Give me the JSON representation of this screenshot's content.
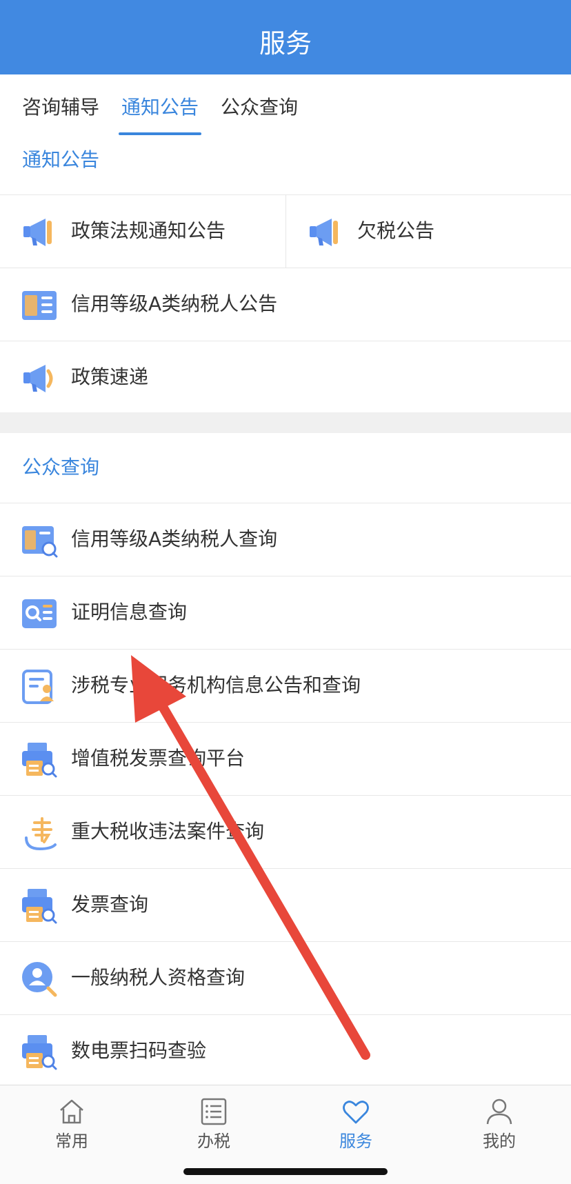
{
  "header": {
    "title": "服务"
  },
  "tabs": [
    {
      "label": "咨询辅导",
      "active": false
    },
    {
      "label": "通知公告",
      "active": true
    },
    {
      "label": "公众查询",
      "active": false
    }
  ],
  "notice_section": {
    "title": "通知公告",
    "items": [
      {
        "label": "政策法规通知公告",
        "icon": "megaphone-icon"
      },
      {
        "label": "欠税公告",
        "icon": "megaphone-icon"
      },
      {
        "label": "信用等级A类纳税人公告",
        "icon": "credit-list-icon"
      },
      {
        "label": "政策速递",
        "icon": "megaphone-icon"
      }
    ]
  },
  "query_section": {
    "title": "公众查询",
    "items": [
      {
        "label": "信用等级A类纳税人查询",
        "icon": "credit-search-icon"
      },
      {
        "label": "证明信息查询",
        "icon": "certificate-search-icon"
      },
      {
        "label": "涉税专业服务机构信息公告和查询",
        "icon": "agency-document-icon"
      },
      {
        "label": "增值税发票查询平台",
        "icon": "invoice-search-icon"
      },
      {
        "label": "重大税收违法案件查询",
        "icon": "violation-icon"
      },
      {
        "label": "发票查询",
        "icon": "invoice-search-icon"
      },
      {
        "label": "一般纳税人资格查询",
        "icon": "person-search-icon"
      },
      {
        "label": "数电票扫码查验",
        "icon": "invoice-search-icon"
      }
    ]
  },
  "bottom_nav": [
    {
      "label": "常用",
      "icon": "home-icon",
      "active": false
    },
    {
      "label": "办税",
      "icon": "list-icon",
      "active": false
    },
    {
      "label": "服务",
      "icon": "heart-icon",
      "active": true
    },
    {
      "label": "我的",
      "icon": "user-icon",
      "active": false
    }
  ],
  "colors": {
    "brand_blue": "#4189e1",
    "accent_orange": "#f5b75e",
    "annotation_red": "#e8473a"
  }
}
